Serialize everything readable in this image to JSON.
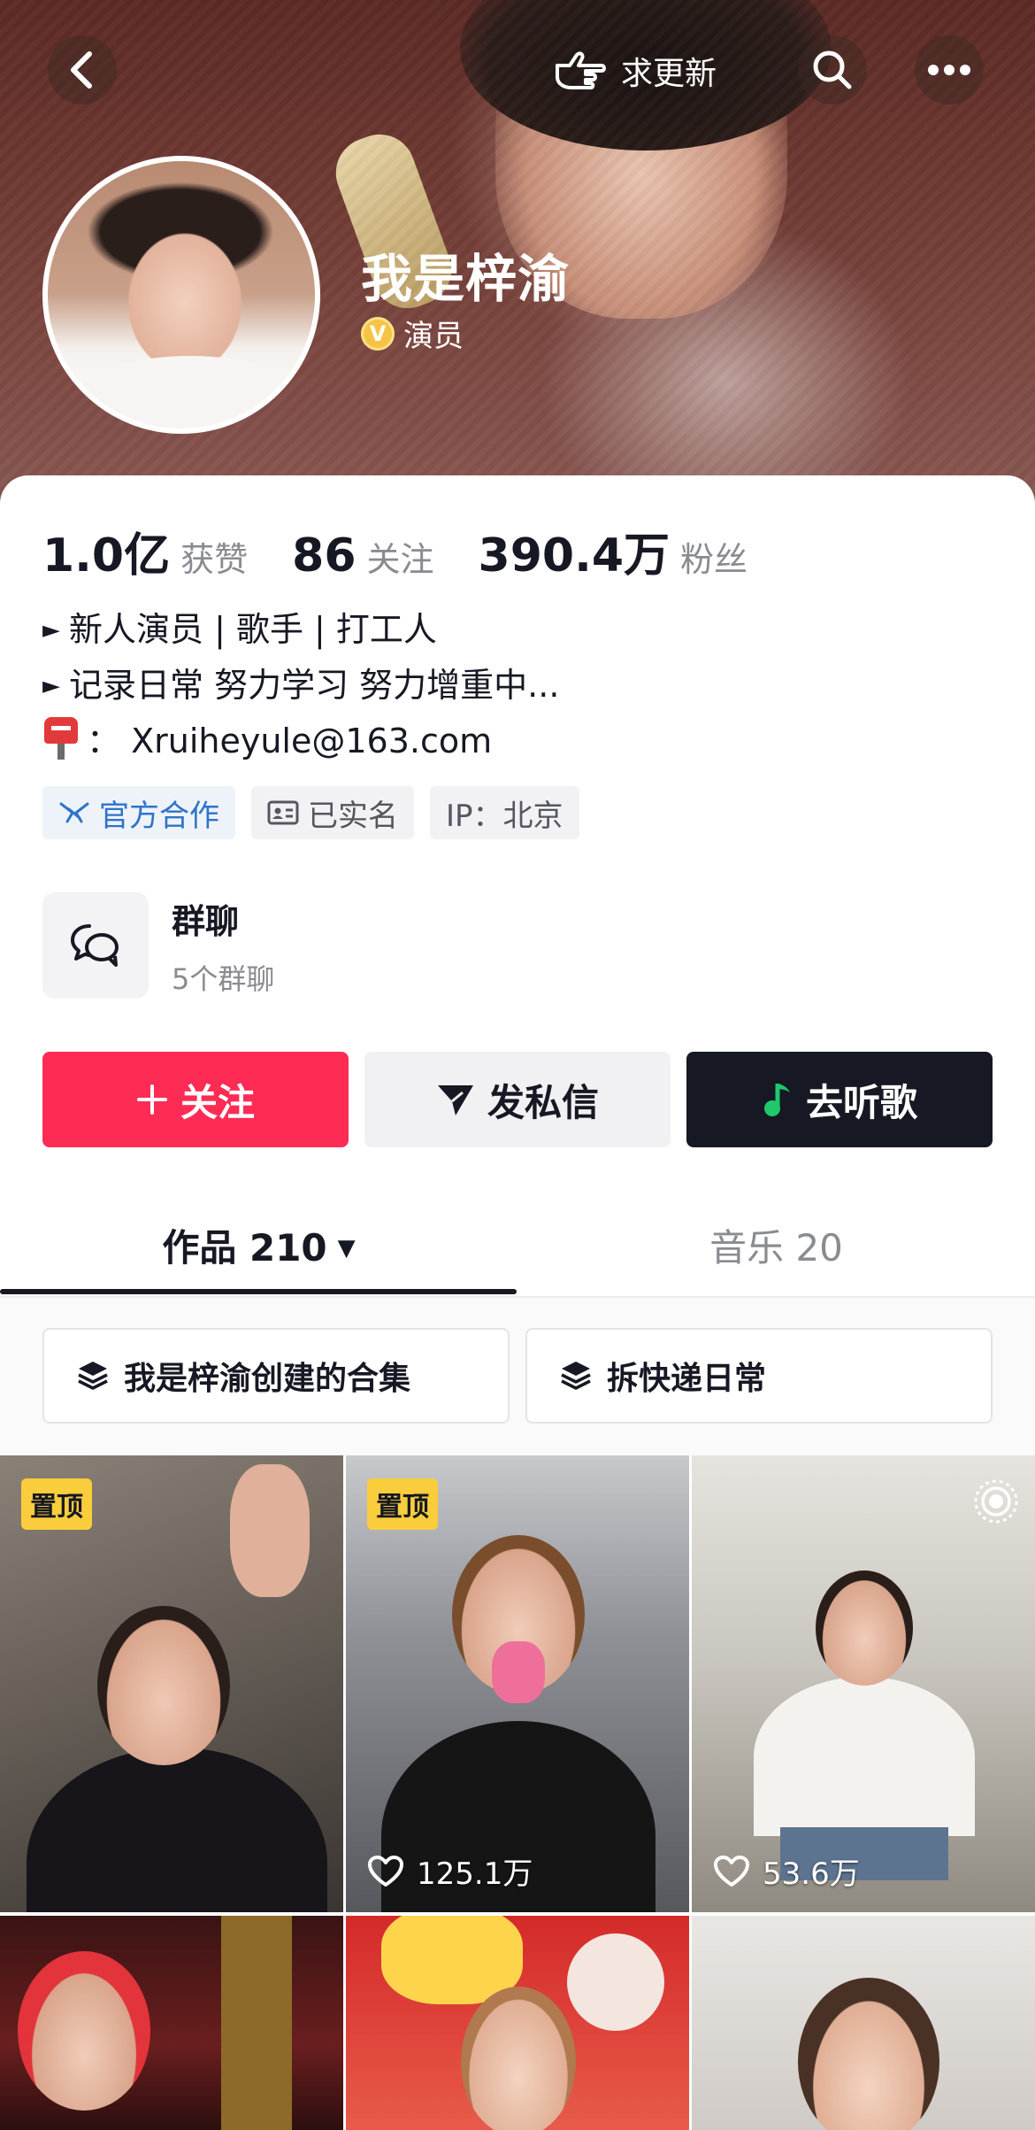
{
  "header": {
    "update_label": "求更新",
    "name": "我是梓渝",
    "verify_badge": "V",
    "verify_label": "演员"
  },
  "stats": [
    {
      "num": "1.0亿",
      "label": "获赞"
    },
    {
      "num": "86",
      "label": "关注"
    },
    {
      "num": "390.4万",
      "label": "粉丝"
    }
  ],
  "bio": {
    "bullet": "►",
    "line1": "新人演员 | 歌手 | 打工人",
    "line2": "记录日常 努力学习 努力增重中...",
    "email": "：  Xruiheyule@163.com"
  },
  "tags": {
    "official": "官方合作",
    "realname": "已实名",
    "ip": "IP：北京"
  },
  "group_chat": {
    "title": "群聊",
    "subtitle": "5个群聊"
  },
  "actions": {
    "follow": "关注",
    "message": "发私信",
    "music": "去听歌"
  },
  "tabs": {
    "works": "作品 210",
    "works_caret": "▼",
    "music": "音乐 20"
  },
  "collections": [
    "我是梓渝创建的合集",
    "拆快递日常"
  ],
  "videos": {
    "pinned_label": "置顶",
    "v2_likes": "125.1万",
    "v3_likes": "53.6万"
  },
  "colors": {
    "accent_red": "#fe2c55",
    "dark": "#161823",
    "pin_yellow": "#facd3c",
    "official_blue": "#2f74c8"
  },
  "icons": [
    "back-icon",
    "hand-point-icon",
    "search-icon",
    "more-icon",
    "verified-icon",
    "mailbox-icon",
    "handshake-icon",
    "id-card-icon",
    "chat-bubbles-icon",
    "plus-icon",
    "send-icon",
    "music-note-icon",
    "caret-down-icon",
    "layers-icon",
    "heart-icon",
    "live-icon"
  ]
}
